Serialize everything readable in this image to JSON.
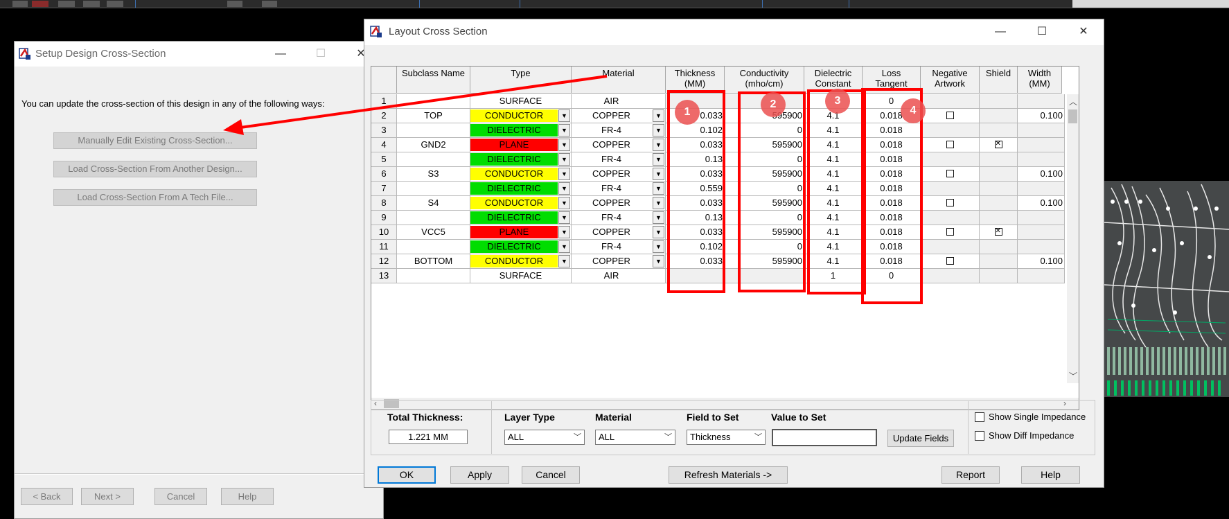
{
  "setup": {
    "title": "Setup Design Cross-Section",
    "message": "You can update the cross-section of this design in any of the following ways:",
    "options": [
      "Manually Edit Existing Cross-Section...",
      "Load Cross-Section From Another Design...",
      "Load Cross-Section From A Tech File..."
    ],
    "nav": {
      "back": "< Back",
      "next": "Next >",
      "cancel": "Cancel",
      "help": "Help"
    }
  },
  "main": {
    "title": "Layout Cross Section",
    "headers": {
      "subclass": "Subclass Name",
      "type": "Type",
      "material": "Material",
      "thickness": [
        "Thickness",
        "(MM)"
      ],
      "conductivity": [
        "Conductivity",
        "(mho/cm)"
      ],
      "dielectric": [
        "Dielectric",
        "Constant"
      ],
      "loss": [
        "Loss",
        "Tangent"
      ],
      "negative": [
        "Negative",
        "Artwork"
      ],
      "shield": "Shield",
      "width": [
        "Width",
        "(MM)"
      ]
    },
    "rows": [
      {
        "num": "1",
        "name": "",
        "type": "SURFACE",
        "material": "AIR",
        "thickness": "",
        "conductivity": "",
        "dk": "",
        "loss": "0",
        "neg": null,
        "shield": null,
        "width": ""
      },
      {
        "num": "2",
        "name": "TOP",
        "type": "CONDUCTOR",
        "material": "COPPER",
        "thickness": "0.033",
        "conductivity": "595900",
        "dk": "4.1",
        "loss": "0.018",
        "neg": false,
        "shield": null,
        "width": "0.100"
      },
      {
        "num": "3",
        "name": "",
        "type": "DIELECTRIC",
        "material": "FR-4",
        "thickness": "0.102",
        "conductivity": "0",
        "dk": "4.1",
        "loss": "0.018",
        "neg": null,
        "shield": null,
        "width": ""
      },
      {
        "num": "4",
        "name": "GND2",
        "type": "PLANE",
        "material": "COPPER",
        "thickness": "0.033",
        "conductivity": "595900",
        "dk": "4.1",
        "loss": "0.018",
        "neg": false,
        "shield": true,
        "width": ""
      },
      {
        "num": "5",
        "name": "",
        "type": "DIELECTRIC",
        "material": "FR-4",
        "thickness": "0.13",
        "conductivity": "0",
        "dk": "4.1",
        "loss": "0.018",
        "neg": null,
        "shield": null,
        "width": ""
      },
      {
        "num": "6",
        "name": "S3",
        "type": "CONDUCTOR",
        "material": "COPPER",
        "thickness": "0.033",
        "conductivity": "595900",
        "dk": "4.1",
        "loss": "0.018",
        "neg": false,
        "shield": null,
        "width": "0.100"
      },
      {
        "num": "7",
        "name": "",
        "type": "DIELECTRIC",
        "material": "FR-4",
        "thickness": "0.559",
        "conductivity": "0",
        "dk": "4.1",
        "loss": "0.018",
        "neg": null,
        "shield": null,
        "width": ""
      },
      {
        "num": "8",
        "name": "S4",
        "type": "CONDUCTOR",
        "material": "COPPER",
        "thickness": "0.033",
        "conductivity": "595900",
        "dk": "4.1",
        "loss": "0.018",
        "neg": false,
        "shield": null,
        "width": "0.100"
      },
      {
        "num": "9",
        "name": "",
        "type": "DIELECTRIC",
        "material": "FR-4",
        "thickness": "0.13",
        "conductivity": "0",
        "dk": "4.1",
        "loss": "0.018",
        "neg": null,
        "shield": null,
        "width": ""
      },
      {
        "num": "10",
        "name": "VCC5",
        "type": "PLANE",
        "material": "COPPER",
        "thickness": "0.033",
        "conductivity": "595900",
        "dk": "4.1",
        "loss": "0.018",
        "neg": false,
        "shield": true,
        "width": ""
      },
      {
        "num": "11",
        "name": "",
        "type": "DIELECTRIC",
        "material": "FR-4",
        "thickness": "0.102",
        "conductivity": "0",
        "dk": "4.1",
        "loss": "0.018",
        "neg": null,
        "shield": null,
        "width": ""
      },
      {
        "num": "12",
        "name": "BOTTOM",
        "type": "CONDUCTOR",
        "material": "COPPER",
        "thickness": "0.033",
        "conductivity": "595900",
        "dk": "4.1",
        "loss": "0.018",
        "neg": false,
        "shield": null,
        "width": "0.100"
      },
      {
        "num": "13",
        "name": "",
        "type": "SURFACE",
        "material": "AIR",
        "thickness": "",
        "conductivity": "",
        "dk": "1",
        "loss": "0",
        "neg": null,
        "shield": null,
        "width": ""
      }
    ],
    "type_colors": {
      "SURFACE": "#ffffff",
      "CONDUCTOR": "#ffff00",
      "DIELECTRIC": "#00dd00",
      "PLANE": "#ff0000"
    },
    "annotations": [
      "1",
      "2",
      "3",
      "4"
    ],
    "bottom": {
      "total_label": "Total Thickness:",
      "total_value": "1.221 MM",
      "layer_type_label": "Layer Type",
      "layer_type_value": "ALL",
      "material_label": "Material",
      "material_value": "ALL",
      "field_label": "Field to Set",
      "field_value": "Thickness",
      "value_label": "Value to Set",
      "value_value": "",
      "update_btn": "Update Fields",
      "show_single": "Show Single Impedance",
      "show_diff": "Show Diff Impedance"
    },
    "buttons": {
      "ok": "OK",
      "apply": "Apply",
      "cancel": "Cancel",
      "refresh": "Refresh Materials ->",
      "report": "Report",
      "help": "Help"
    }
  }
}
